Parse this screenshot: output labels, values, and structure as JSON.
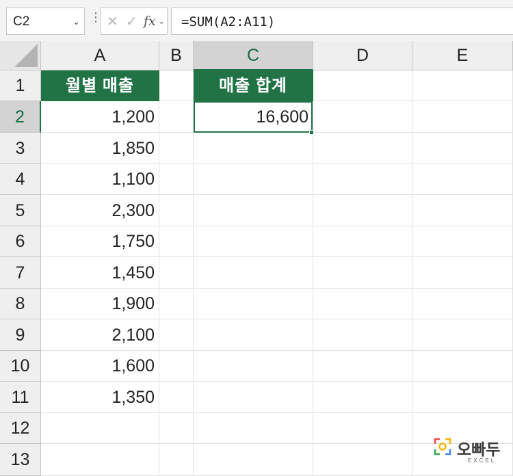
{
  "formula_bar": {
    "name_box": "C2",
    "fx_label": "fx",
    "formula": "=SUM(A2:A11)"
  },
  "columns": [
    "A",
    "B",
    "C",
    "D",
    "E"
  ],
  "selected_column": "C",
  "rows": [
    "1",
    "2",
    "3",
    "4",
    "5",
    "6",
    "7",
    "8",
    "9",
    "10",
    "11",
    "12",
    "13"
  ],
  "selected_row": "2",
  "cells": {
    "A1": "월별 매출",
    "A2": "1,200",
    "A3": "1,850",
    "A4": "1,100",
    "A5": "2,300",
    "A6": "1,750",
    "A7": "1,450",
    "A8": "1,900",
    "A9": "2,100",
    "A10": "1,600",
    "A11": "1,350",
    "C1": "매출 합계",
    "C2": "16,600"
  },
  "header_fill_color": "#217346",
  "logo": {
    "name": "오빠두",
    "sub": "EXCEL"
  }
}
